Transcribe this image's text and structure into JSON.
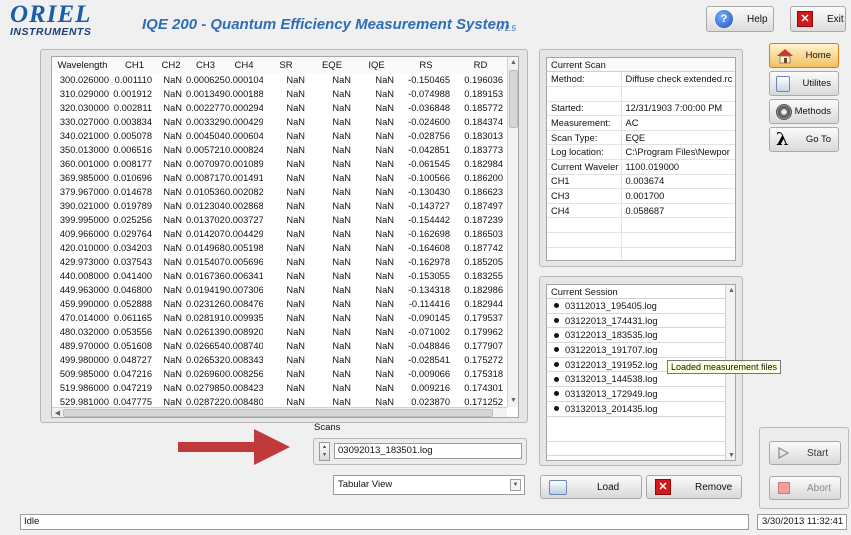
{
  "header": {
    "logo_line1": "ORIEL",
    "logo_line2": "INSTRUMENTS",
    "title": "IQE 200 - Quantum Efficiency Measurement System",
    "version": "v. 2.5",
    "help_label": "Help",
    "exit_label": "Exit"
  },
  "table": {
    "columns": [
      "Wavelength",
      "CH1",
      "CH2",
      "CH3",
      "CH4",
      "SR",
      "EQE",
      "IQE",
      "RS",
      "RD"
    ],
    "rows": [
      [
        "300.026000",
        "0.001110",
        "NaN",
        "0.000625",
        "0.000104",
        "NaN",
        "NaN",
        "NaN",
        "-0.150465",
        "0.196036"
      ],
      [
        "310.029000",
        "0.001912",
        "NaN",
        "0.001349",
        "0.000188",
        "NaN",
        "NaN",
        "NaN",
        "-0.074988",
        "0.189153"
      ],
      [
        "320.030000",
        "0.002811",
        "NaN",
        "0.002277",
        "0.000294",
        "NaN",
        "NaN",
        "NaN",
        "-0.036848",
        "0.185772"
      ],
      [
        "330.027000",
        "0.003834",
        "NaN",
        "0.003329",
        "0.000429",
        "NaN",
        "NaN",
        "NaN",
        "-0.024600",
        "0.184374"
      ],
      [
        "340.021000",
        "0.005078",
        "NaN",
        "0.004504",
        "0.000604",
        "NaN",
        "NaN",
        "NaN",
        "-0.028756",
        "0.183013"
      ],
      [
        "350.013000",
        "0.006516",
        "NaN",
        "0.005721",
        "0.000824",
        "NaN",
        "NaN",
        "NaN",
        "-0.042851",
        "0.183773"
      ],
      [
        "360.001000",
        "0.008177",
        "NaN",
        "0.007097",
        "0.001089",
        "NaN",
        "NaN",
        "NaN",
        "-0.061545",
        "0.182984"
      ],
      [
        "369.985000",
        "0.010696",
        "NaN",
        "0.008717",
        "0.001491",
        "NaN",
        "NaN",
        "NaN",
        "-0.100566",
        "0.186200"
      ],
      [
        "379.967000",
        "0.014678",
        "NaN",
        "0.010536",
        "0.002082",
        "NaN",
        "NaN",
        "NaN",
        "-0.130430",
        "0.186623"
      ],
      [
        "390.021000",
        "0.019789",
        "NaN",
        "0.012304",
        "0.002868",
        "NaN",
        "NaN",
        "NaN",
        "-0.143727",
        "0.187497"
      ],
      [
        "399.995000",
        "0.025256",
        "NaN",
        "0.013702",
        "0.003727",
        "NaN",
        "NaN",
        "NaN",
        "-0.154442",
        "0.187239"
      ],
      [
        "409.966000",
        "0.029764",
        "NaN",
        "0.014207",
        "0.004429",
        "NaN",
        "NaN",
        "NaN",
        "-0.162698",
        "0.186503"
      ],
      [
        "420.010000",
        "0.034203",
        "NaN",
        "0.014968",
        "0.005198",
        "NaN",
        "NaN",
        "NaN",
        "-0.164608",
        "0.187742"
      ],
      [
        "429.973000",
        "0.037543",
        "NaN",
        "0.015407",
        "0.005696",
        "NaN",
        "NaN",
        "NaN",
        "-0.162978",
        "0.185205"
      ],
      [
        "440.008000",
        "0.041400",
        "NaN",
        "0.016736",
        "0.006341",
        "NaN",
        "NaN",
        "NaN",
        "-0.153055",
        "0.183255"
      ],
      [
        "449.963000",
        "0.046800",
        "NaN",
        "0.019419",
        "0.007306",
        "NaN",
        "NaN",
        "NaN",
        "-0.134318",
        "0.182986"
      ],
      [
        "459.990000",
        "0.052888",
        "NaN",
        "0.023126",
        "0.008476",
        "NaN",
        "NaN",
        "NaN",
        "-0.114416",
        "0.182944"
      ],
      [
        "470.014000",
        "0.061165",
        "NaN",
        "0.028191",
        "0.009935",
        "NaN",
        "NaN",
        "NaN",
        "-0.090145",
        "0.179537"
      ],
      [
        "480.032000",
        "0.053556",
        "NaN",
        "0.026139",
        "0.008920",
        "NaN",
        "NaN",
        "NaN",
        "-0.071002",
        "0.179962"
      ],
      [
        "489.970000",
        "0.051608",
        "NaN",
        "0.026654",
        "0.008740",
        "NaN",
        "NaN",
        "NaN",
        "-0.048846",
        "0.177907"
      ],
      [
        "499.980000",
        "0.048727",
        "NaN",
        "0.026532",
        "0.008343",
        "NaN",
        "NaN",
        "NaN",
        "-0.028541",
        "0.175272"
      ],
      [
        "509.985000",
        "0.047216",
        "NaN",
        "0.026960",
        "0.008256",
        "NaN",
        "NaN",
        "NaN",
        "-0.009066",
        "0.175318"
      ],
      [
        "519.986000",
        "0.047219",
        "NaN",
        "0.027985",
        "0.008423",
        "NaN",
        "NaN",
        "NaN",
        "0.009216",
        "0.174301"
      ],
      [
        "529.981000",
        "0.047775",
        "NaN",
        "0.028722",
        "0.008480",
        "NaN",
        "NaN",
        "NaN",
        "0.023870",
        "0.171252"
      ]
    ]
  },
  "current_scan": {
    "title": "Current Scan",
    "rows": [
      [
        "Method:",
        "Diffuse check extended.rc"
      ],
      [
        "",
        ""
      ],
      [
        "Started:",
        "12/31/1903 7:00:00 PM"
      ],
      [
        "Measurement:",
        "AC"
      ],
      [
        "Scan Type:",
        "EQE"
      ],
      [
        "Log location:",
        "C:\\Program Files\\Newpor"
      ],
      [
        "Current Waveler",
        "1100.019000"
      ],
      [
        "CH1",
        "0.003674"
      ],
      [
        "CH3",
        "0.001700"
      ],
      [
        "CH4",
        "0.058687"
      ],
      [
        "",
        ""
      ],
      [
        "",
        ""
      ],
      [
        "",
        ""
      ],
      [
        "",
        ""
      ],
      [
        "",
        ""
      ]
    ]
  },
  "current_session": {
    "title": "Current Session",
    "items": [
      "03112013_195405.log",
      "03122013_174431.log",
      "03122013_183535.log",
      "03122013_191707.log",
      "03122013_191952.log",
      "03132013_144538.log",
      "03132013_172949.log",
      "03132013_201435.log"
    ],
    "tooltip": "Loaded measurement files"
  },
  "scans": {
    "label": "Scans",
    "value": "03092013_183501.log"
  },
  "view_select": {
    "value": "Tabular View"
  },
  "buttons": {
    "load": "Load",
    "remove": "Remove",
    "start": "Start",
    "abort": "Abort"
  },
  "side_nav": {
    "home": "Home",
    "utilities": "Utilites",
    "methods": "Methods",
    "goto": "Go To"
  },
  "status": {
    "text": "Idle",
    "datetime": "3/30/2013 11:32:41"
  },
  "colors": {
    "brand": "#1d5ca8",
    "arrow": "#c0393b"
  }
}
